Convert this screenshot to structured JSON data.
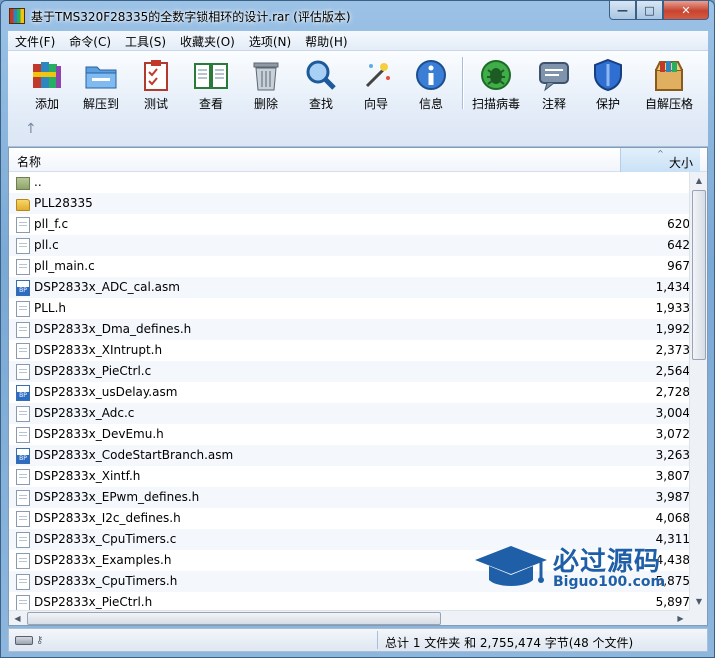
{
  "window": {
    "title": "基于TMS320F28335的全数字锁相环的设计.rar (评估版本)",
    "controls": [
      "—",
      "□",
      "✕"
    ]
  },
  "menu": [
    "文件(F)",
    "命令(C)",
    "工具(S)",
    "收藏夹(O)",
    "选项(N)",
    "帮助(H)"
  ],
  "toolbar": [
    {
      "label": "添加",
      "icon": "books-add-icon"
    },
    {
      "label": "解压到",
      "icon": "folder-extract-icon"
    },
    {
      "label": "测试",
      "icon": "clipboard-test-icon"
    },
    {
      "label": "查看",
      "icon": "book-view-icon"
    },
    {
      "label": "删除",
      "icon": "trash-icon"
    },
    {
      "label": "查找",
      "icon": "magnifier-icon"
    },
    {
      "label": "向导",
      "icon": "wand-icon"
    },
    {
      "label": "信息",
      "icon": "info-icon"
    },
    {
      "label": "扫描病毒",
      "icon": "bug-scan-icon"
    },
    {
      "label": "注释",
      "icon": "comment-icon"
    },
    {
      "label": "保护",
      "icon": "shield-icon"
    },
    {
      "label": "自解压格",
      "icon": "sfx-box-icon"
    }
  ],
  "up_arrow": "↑",
  "columns": {
    "name": "名称",
    "size": "大小",
    "sort_indicator": "^"
  },
  "files": [
    {
      "name": "..",
      "size": "",
      "type": "up"
    },
    {
      "name": "PLL28335",
      "size": "",
      "type": "folder"
    },
    {
      "name": "pll_f.c",
      "size": "620",
      "type": "file"
    },
    {
      "name": "pll.c",
      "size": "642",
      "type": "file"
    },
    {
      "name": "pll_main.c",
      "size": "967",
      "type": "file"
    },
    {
      "name": "DSP2833x_ADC_cal.asm",
      "size": "1,434",
      "type": "asm"
    },
    {
      "name": "PLL.h",
      "size": "1,933",
      "type": "file"
    },
    {
      "name": "DSP2833x_Dma_defines.h",
      "size": "1,992",
      "type": "file"
    },
    {
      "name": "DSP2833x_XIntrupt.h",
      "size": "2,373",
      "type": "file"
    },
    {
      "name": "DSP2833x_PieCtrl.c",
      "size": "2,564",
      "type": "file"
    },
    {
      "name": "DSP2833x_usDelay.asm",
      "size": "2,728",
      "type": "asm"
    },
    {
      "name": "DSP2833x_Adc.c",
      "size": "3,004",
      "type": "file"
    },
    {
      "name": "DSP2833x_DevEmu.h",
      "size": "3,072",
      "type": "file"
    },
    {
      "name": "DSP2833x_CodeStartBranch.asm",
      "size": "3,263",
      "type": "asm"
    },
    {
      "name": "DSP2833x_Xintf.h",
      "size": "3,807",
      "type": "file"
    },
    {
      "name": "DSP2833x_EPwm_defines.h",
      "size": "3,987",
      "type": "file"
    },
    {
      "name": "DSP2833x_I2c_defines.h",
      "size": "4,068",
      "type": "file"
    },
    {
      "name": "DSP2833x_CpuTimers.c",
      "size": "4,311",
      "type": "file"
    },
    {
      "name": "DSP2833x_Examples.h",
      "size": "4,438",
      "type": "file"
    },
    {
      "name": "DSP2833x_CpuTimers.h",
      "size": "5,875",
      "type": "file"
    },
    {
      "name": "DSP2833x_PieCtrl.h",
      "size": "5,897",
      "type": "file"
    }
  ],
  "status": {
    "summary": "总计 1 文件夹 和 2,755,474 字节(48 个文件)"
  },
  "watermark": {
    "cn": "必过源码",
    "en": "Biguo100.com"
  },
  "colors": {
    "title_gradient_top": "#9cc2e6",
    "toolbar_bg": "#e4edf8",
    "selected_col_header": "#c9e1f6",
    "watermark_blue": "#1f5fa8"
  }
}
